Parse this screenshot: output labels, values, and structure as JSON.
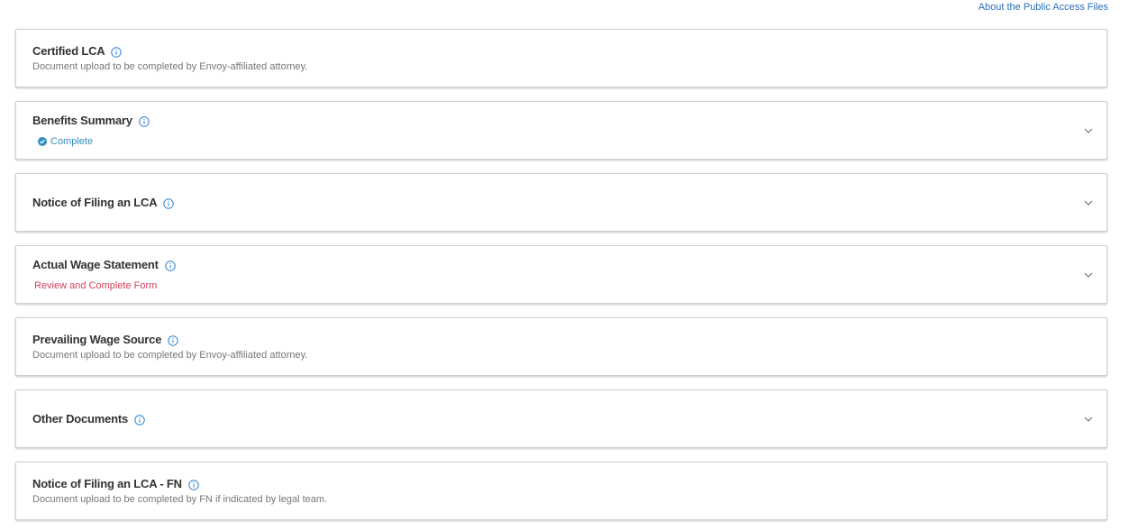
{
  "header": {
    "public_access_link": "About the Public Access Files"
  },
  "colors": {
    "link": "#2a6ebb",
    "info_icon": "#2a7fd4",
    "complete": "#2f8fbf",
    "action_required": "#d0425c"
  },
  "sections": [
    {
      "title": "Certified LCA",
      "subtitle": "Document upload to be completed by Envoy-affiliated attorney."
    },
    {
      "title": "Benefits Summary",
      "status": "Complete",
      "status_icon": "check-circle-icon"
    },
    {
      "title": "Notice of Filing an LCA"
    },
    {
      "title": "Actual Wage Statement",
      "action": "Review and Complete Form"
    },
    {
      "title": "Prevailing Wage Source",
      "subtitle": "Document upload to be completed by Envoy-affiliated attorney."
    },
    {
      "title": "Other Documents"
    },
    {
      "title": "Notice of Filing an LCA - FN",
      "subtitle": "Document upload to be completed by FN if indicated by legal team."
    }
  ]
}
